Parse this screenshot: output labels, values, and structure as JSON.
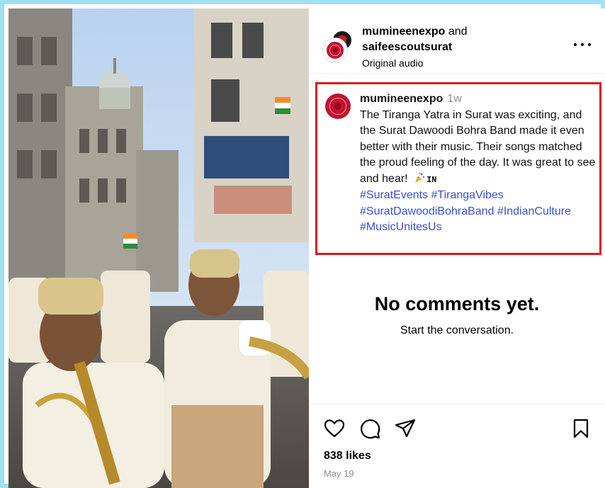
{
  "header": {
    "username_primary": "mumineenexpo",
    "joiner": "and",
    "username_collab": "saifeescoutsurat",
    "audio": "Original audio"
  },
  "caption": {
    "username": "mumineenexpo",
    "time": "1w",
    "body": "The Tiranga Yatra in Surat was exciting, and the Surat Dawoodi Bohra Band made it even better with their music. Their songs matched the proud feeling of the day. It was great to see and hear!",
    "flag": "IN",
    "hashtags": [
      "#SuratEvents",
      "#TirangaVibes",
      "#SuratDawoodiBohraBand",
      "#IndianCulture",
      "#MusicUnitesUs"
    ]
  },
  "comments": {
    "empty_title": "No comments yet.",
    "empty_subtitle": "Start the conversation."
  },
  "footer": {
    "likes": "838 likes",
    "date": "May 19"
  },
  "icons": {
    "like": "heart-icon",
    "comment": "comment-icon",
    "share": "paper-plane-icon",
    "save": "bookmark-icon",
    "more": "more-options-icon"
  },
  "colors": {
    "highlight_border": "#e0141e",
    "hashtag": "#3b4fd1",
    "frame": "#9fe0f3",
    "secondary_text": "#8e8e8e"
  }
}
